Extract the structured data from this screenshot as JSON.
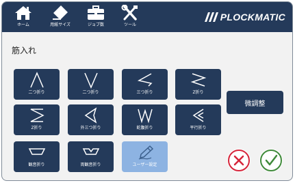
{
  "nav": {
    "home": {
      "label": "ホーム",
      "icon": "home-icon"
    },
    "paper_size": {
      "label": "用紙サイズ",
      "icon": "paper-tag-icon"
    },
    "job_count": {
      "label": "ジョブ数",
      "icon": "briefcase-icon"
    },
    "tools": {
      "label": "ツール",
      "icon": "tools-icon"
    }
  },
  "brand": {
    "name": "PLOCKMATIC",
    "icon": "brand-slashes-icon"
  },
  "page": {
    "title": "筋入れ"
  },
  "fold_buttons": [
    {
      "label": "二つ折り",
      "icon": "fold-peak-icon"
    },
    {
      "label": "二つ折り",
      "icon": "fold-valley-icon"
    },
    {
      "label": "三つ折り",
      "icon": "fold-letter-icon"
    },
    {
      "label": "Z折り",
      "icon": "fold-z-icon"
    },
    {
      "label": "Z折り",
      "icon": "fold-z-alt-icon"
    },
    {
      "label": "外三つ折り",
      "icon": "fold-outer-letter-icon"
    },
    {
      "label": "蛇腹折り",
      "icon": "fold-accordion-icon"
    },
    {
      "label": "平行折り",
      "icon": "fold-parallel-icon"
    },
    {
      "label": "観音折り",
      "icon": "fold-gate-icon"
    },
    {
      "label": "両観音折り",
      "icon": "fold-double-gate-icon"
    },
    {
      "label": "ユーザー設定",
      "icon": "user-pen-icon"
    }
  ],
  "actions": {
    "fine_adjust": "微調整",
    "cancel": "cancel-x-icon",
    "confirm": "confirm-check-icon"
  },
  "colors": {
    "navy": "#243a5a",
    "light_blue": "#8db3e2",
    "cancel_red": "#d6243a",
    "confirm_green": "#3f8a3a"
  }
}
